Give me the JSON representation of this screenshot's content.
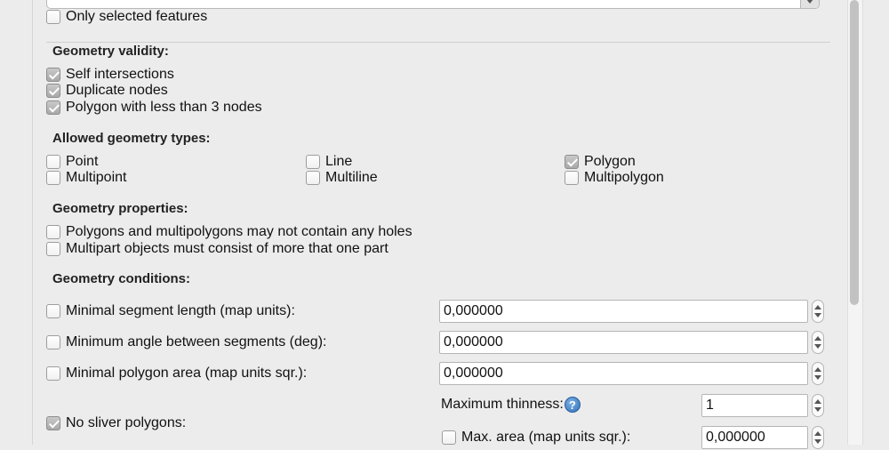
{
  "top": {
    "only_selected": {
      "label": "Only selected features",
      "checked": false
    }
  },
  "validity": {
    "heading": "Geometry validity:",
    "items": [
      {
        "label": "Self intersections",
        "checked": true
      },
      {
        "label": "Duplicate nodes",
        "checked": true
      },
      {
        "label": "Polygon with less than 3 nodes",
        "checked": true
      }
    ]
  },
  "types": {
    "heading": "Allowed geometry types:",
    "point": {
      "label": "Point",
      "checked": false
    },
    "multipoint": {
      "label": "Multipoint",
      "checked": false
    },
    "line": {
      "label": "Line",
      "checked": false
    },
    "multiline": {
      "label": "Multiline",
      "checked": false
    },
    "polygon": {
      "label": "Polygon",
      "checked": true
    },
    "multipolygon": {
      "label": "Multipolygon",
      "checked": false
    }
  },
  "properties": {
    "heading": "Geometry properties:",
    "items": [
      {
        "label": "Polygons and multipolygons may not contain any holes",
        "checked": false
      },
      {
        "label": "Multipart objects must consist of more that one part",
        "checked": false
      }
    ]
  },
  "conditions": {
    "heading": "Geometry conditions:",
    "min_segment": {
      "label": "Minimal segment length (map units):",
      "checked": false,
      "value": "0,000000"
    },
    "min_angle": {
      "label": "Minimum angle between segments (deg):",
      "checked": false,
      "value": "0,000000"
    },
    "min_area": {
      "label": "Minimal polygon area (map units sqr.):",
      "checked": false,
      "value": "0,000000"
    },
    "sliver": {
      "label": "No sliver polygons:",
      "checked": true,
      "max_thinness_label": "Maximum thinness:",
      "max_thinness_value": "1",
      "max_area_label": "Max. area (map units sqr.):",
      "max_area_checked": false,
      "max_area_value": "0,000000"
    }
  },
  "icons": {
    "help": "?"
  }
}
